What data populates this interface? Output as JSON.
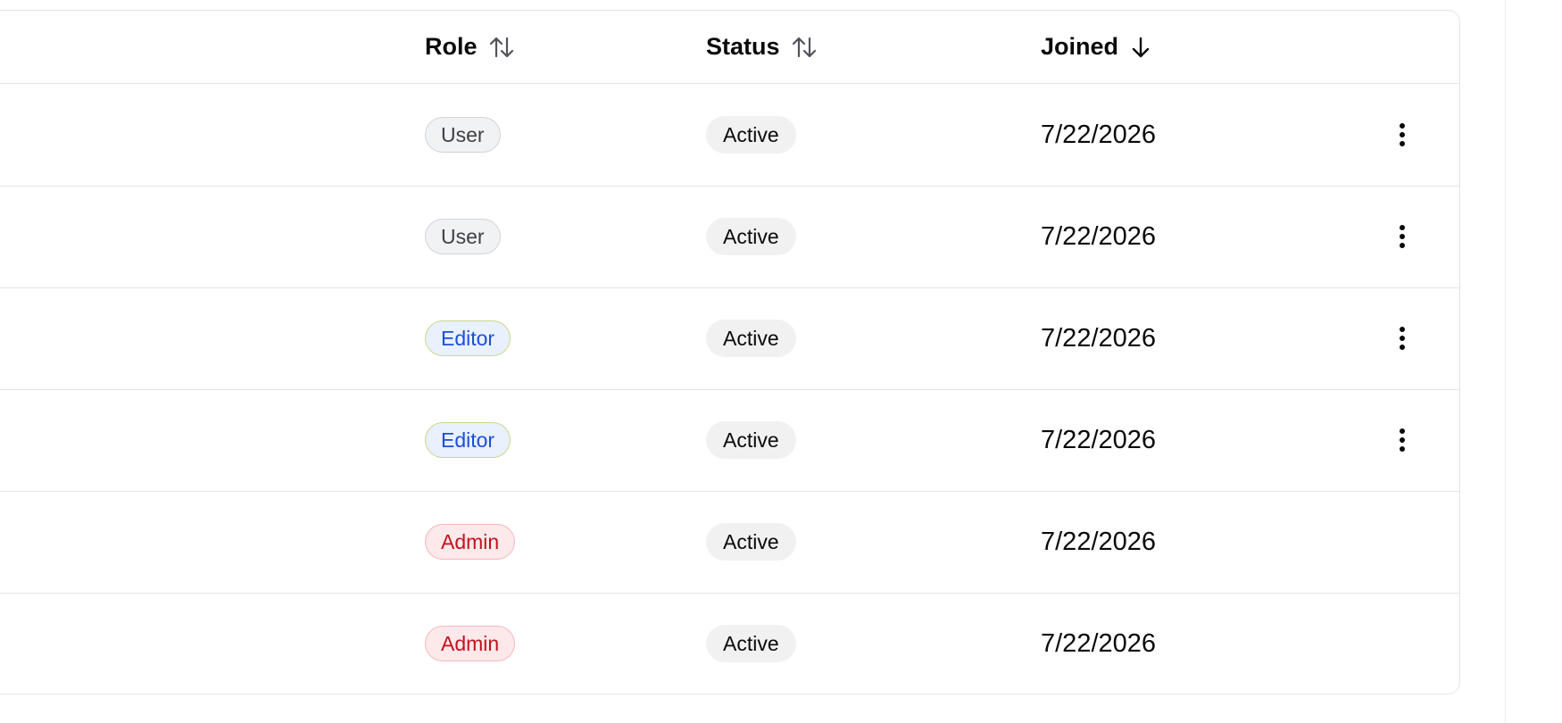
{
  "table": {
    "columns": [
      {
        "key": "role",
        "label": "Role",
        "sort": "unsorted"
      },
      {
        "key": "status",
        "label": "Status",
        "sort": "unsorted"
      },
      {
        "key": "joined",
        "label": "Joined",
        "sort": "descending"
      }
    ],
    "rows": [
      {
        "role": "User",
        "role_type": "user",
        "status": "Active",
        "joined": "7/22/2026",
        "has_actions": true
      },
      {
        "role": "User",
        "role_type": "user",
        "status": "Active",
        "joined": "7/22/2026",
        "has_actions": true
      },
      {
        "role": "Editor",
        "role_type": "editor",
        "status": "Active",
        "joined": "7/22/2026",
        "has_actions": true
      },
      {
        "role": "Editor",
        "role_type": "editor",
        "status": "Active",
        "joined": "7/22/2026",
        "has_actions": true
      },
      {
        "role": "Admin",
        "role_type": "admin",
        "status": "Active",
        "joined": "7/22/2026",
        "has_actions": false
      },
      {
        "role": "Admin",
        "role_type": "admin",
        "status": "Active",
        "joined": "7/22/2026",
        "has_actions": false
      }
    ]
  },
  "icons": {
    "sort_unsorted": "arrow-up-down-icon",
    "sort_descending": "arrow-down-icon",
    "row_actions": "more-vertical-icon"
  },
  "colors": {
    "role_user": {
      "bg": "#f1f2f4",
      "border": "#d4d4d8",
      "text": "#3f3f46"
    },
    "role_editor": {
      "bg": "#e8f1fd",
      "border": "#c9d98a",
      "text": "#1d4ed8"
    },
    "role_admin": {
      "bg": "#fde8ea",
      "border": "#f6b8be",
      "text": "#c1121f"
    },
    "status_active_bg": "#f1f1f2",
    "border": "#e4e4e7"
  }
}
